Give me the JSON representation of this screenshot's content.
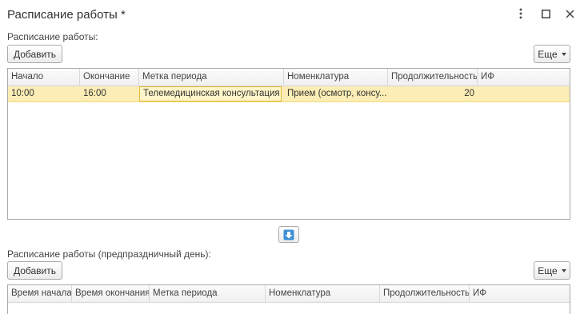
{
  "window": {
    "title": "Расписание работы *",
    "menu_icon": "more-vertical-icon",
    "maximize_icon": "maximize-icon",
    "close_icon": "close-icon"
  },
  "schedule": {
    "label": "Расписание работы:",
    "add_button": "Добавить",
    "more_button": "Еще",
    "columns": [
      "Начало",
      "Окончание",
      "Метка периода",
      "Номенклатура",
      "Продолжительность",
      "ИФ"
    ],
    "rows": [
      {
        "start": "10:00",
        "end": "16:00",
        "period_mark": "Телемедицинская консультация",
        "nomenclature": "Прием (осмотр, консу...",
        "duration": "20",
        "if": ""
      }
    ]
  },
  "move_down_icon": "arrow-down-icon",
  "holiday_schedule": {
    "label": "Расписание работы (предпраздничный день):",
    "add_button": "Добавить",
    "more_button": "Еще",
    "columns": [
      "Время начала",
      "Время окончания",
      "Метка периода",
      "Номенклатура",
      "Продолжительность",
      "ИФ"
    ]
  },
  "colors": {
    "selected_row": "#fbedb5",
    "active_cell_border": "#e2b93b",
    "arrow_icon": "#3d8fd6"
  }
}
